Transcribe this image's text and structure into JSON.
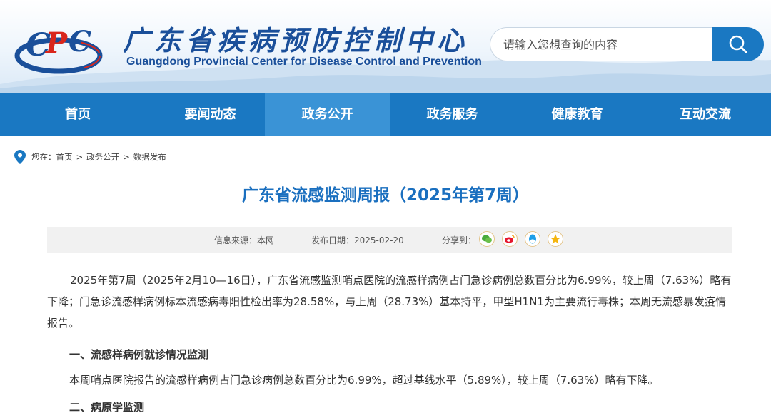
{
  "header": {
    "title_cn": "广东省疾病预防控制中心",
    "title_en": "Guangdong Provincial Center for Disease Control and Prevention",
    "logo_name": "cdc-logo",
    "search_placeholder": "请输入您想查询的内容",
    "search_icon": "search-icon"
  },
  "nav": [
    "首页",
    "要闻动态",
    "政务公开",
    "政务服务",
    "健康教育",
    "互动交流"
  ],
  "breadcrumb": {
    "prefix": "您在：",
    "items": [
      "首页",
      "政务公开",
      "数据发布"
    ]
  },
  "article": {
    "title": "广东省流感监测周报（2025年第7周）",
    "source": "信息来源：本网",
    "date": "发布日期：2025-02-20",
    "share_label": "分享到：",
    "share_icons": [
      "wechat-icon",
      "weibo-icon",
      "qq-icon",
      "qzone-icon"
    ],
    "para1": "2025年第7周（2025年2月10—16日），广东省流感监测哨点医院的流感样病例占门急诊病例总数百分比为6.99%，较上周（7.63%）略有下降；门急诊流感样病例标本流感病毒阳性检出率为28.58%，与上周（28.73%）基本持平，甲型H1N1为主要流行毒株；本周无流感暴发疫情报告。",
    "heading1": "一、流感样病例就诊情况监测",
    "para2": "本周哨点医院报告的流感样病例占门急诊病例总数百分比为6.99%，超过基线水平（5.89%），较上周（7.63%）略有下降。",
    "heading2": "二、病原学监测"
  },
  "colors": {
    "primary": "#1a78c2",
    "nav_active": "#3a93d6",
    "title": "#1a6fbf",
    "logo_red": "#d9261c"
  }
}
